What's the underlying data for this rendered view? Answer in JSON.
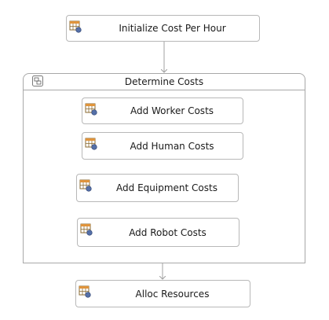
{
  "nodes": {
    "init": "Initialize Cost Per Hour",
    "worker": "Add Worker Costs",
    "human": "Add Human Costs",
    "equipment": "Add Equipment Costs",
    "robot": "Add Robot Costs",
    "alloc": "Alloc Resources"
  },
  "container": {
    "title": "Determine Costs"
  },
  "icons": {
    "task": "task-table-icon",
    "group": "collapse-group-icon"
  },
  "colors": {
    "border": "#b8b8b8",
    "connector": "#a0a0a0",
    "icon_header": "#e0943c",
    "icon_grid": "#8a6a30",
    "icon_badge": "#5570a8"
  }
}
